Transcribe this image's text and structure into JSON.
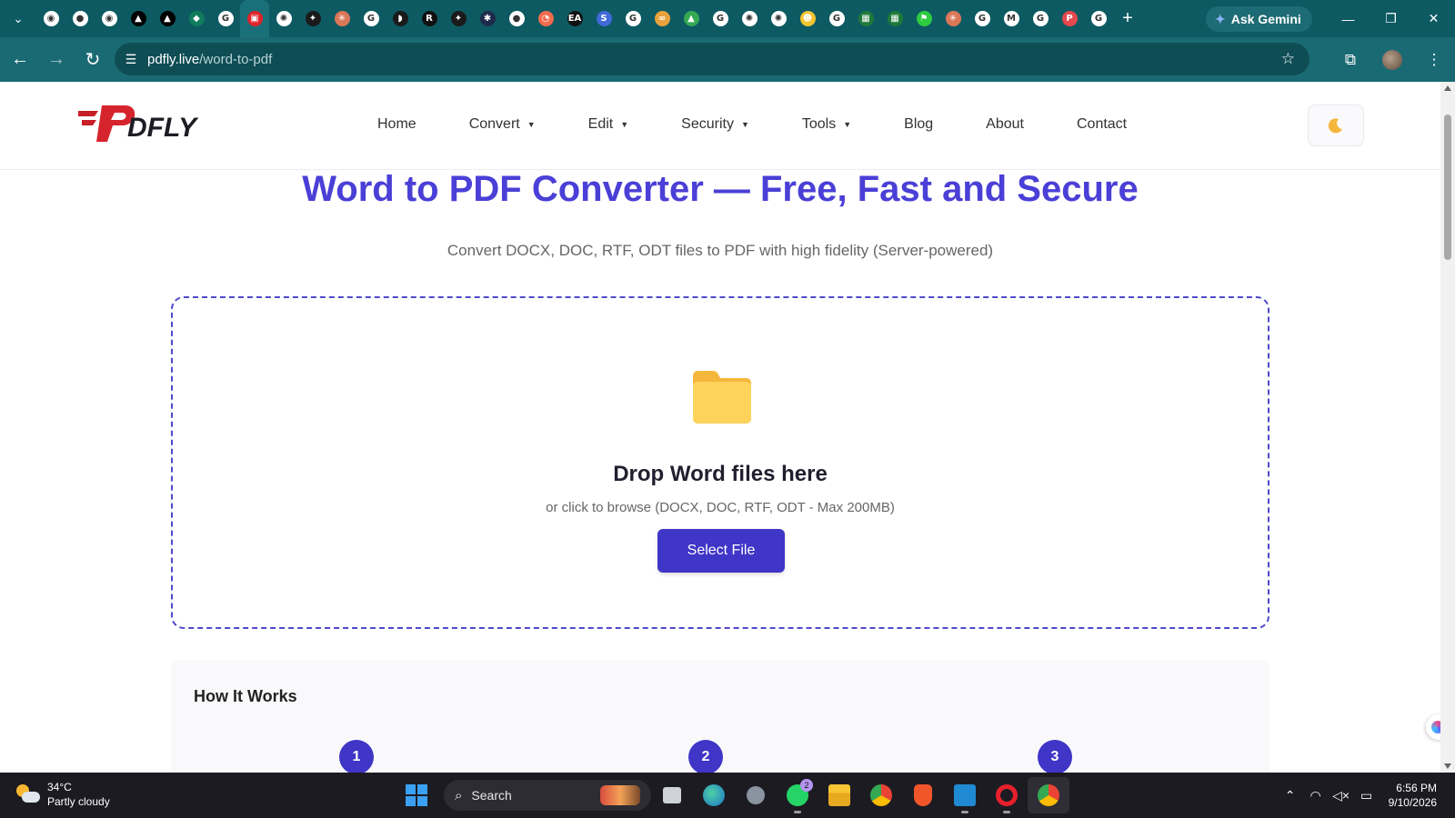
{
  "browser": {
    "tab_icons": [
      {
        "icon": "chrome-icon",
        "color": "#ffffff",
        "glyph": "◉"
      },
      {
        "icon": "github-icon",
        "color": "#ffffff",
        "glyph": "●"
      },
      {
        "icon": "chrome-icon",
        "color": "#ffffff",
        "glyph": "◉"
      },
      {
        "icon": "vercel-icon",
        "color": "#000000",
        "glyph": "▲"
      },
      {
        "icon": "vercel-icon",
        "color": "#000000",
        "glyph": "▲"
      },
      {
        "icon": "shield-icon",
        "color": "#0f7c5c",
        "glyph": "◆"
      },
      {
        "icon": "google-icon",
        "color": "#ffffff",
        "glyph": "G"
      },
      {
        "icon": "pdfly-icon",
        "color": "#e0242b",
        "glyph": "▣"
      },
      {
        "icon": "openai-icon",
        "color": "#ffffff",
        "glyph": "✺"
      },
      {
        "icon": "gemini-icon",
        "color": "#1a1a1a",
        "glyph": "✦"
      },
      {
        "icon": "claude-icon",
        "color": "#d97757",
        "glyph": "✳"
      },
      {
        "icon": "google-icon",
        "color": "#ffffff",
        "glyph": "G"
      },
      {
        "icon": "deepseek-icon",
        "color": "#1a1a1a",
        "glyph": "◗"
      },
      {
        "icon": "r-icon",
        "color": "#111111",
        "glyph": "R"
      },
      {
        "icon": "gemini-icon",
        "color": "#1a1a1a",
        "glyph": "✦"
      },
      {
        "icon": "perplexity-icon",
        "color": "#1e2a4a",
        "glyph": "✱"
      },
      {
        "icon": "github-icon",
        "color": "#ffffff",
        "glyph": "●"
      },
      {
        "icon": "clock-icon",
        "color": "#f26b4e",
        "glyph": "◔"
      },
      {
        "icon": "ea-icon",
        "color": "#111111",
        "glyph": "EA"
      },
      {
        "icon": "stripe-icon",
        "color": "#3f6ad8",
        "glyph": "S"
      },
      {
        "icon": "google-icon",
        "color": "#ffffff",
        "glyph": "G"
      },
      {
        "icon": "infinity-icon",
        "color": "#e9a23b",
        "glyph": "∞"
      },
      {
        "icon": "drive-icon",
        "color": "#34a853",
        "glyph": "▲"
      },
      {
        "icon": "google-icon",
        "color": "#ffffff",
        "glyph": "G"
      },
      {
        "icon": "openai-icon",
        "color": "#ffffff",
        "glyph": "✺"
      },
      {
        "icon": "openai-icon",
        "color": "#ffffff",
        "glyph": "✺"
      },
      {
        "icon": "ghost-icon",
        "color": "#f4c430",
        "glyph": "☻"
      },
      {
        "icon": "google-icon",
        "color": "#ffffff",
        "glyph": "G"
      },
      {
        "icon": "app-icon",
        "color": "#1f7a3a",
        "glyph": "▦"
      },
      {
        "icon": "app-icon",
        "color": "#1f7a3a",
        "glyph": "▦"
      },
      {
        "icon": "flag-icon",
        "color": "#2ecc40",
        "glyph": "⚑"
      },
      {
        "icon": "claude-icon",
        "color": "#d97757",
        "glyph": "✳"
      },
      {
        "icon": "google-icon",
        "color": "#ffffff",
        "glyph": "G"
      },
      {
        "icon": "gmail-icon",
        "color": "#ffffff",
        "glyph": "M"
      },
      {
        "icon": "google-icon",
        "color": "#ffffff",
        "glyph": "G"
      },
      {
        "icon": "p-icon",
        "color": "#e5484d",
        "glyph": "P"
      },
      {
        "icon": "google-icon",
        "color": "#ffffff",
        "glyph": "G"
      }
    ],
    "ask_gemini": "Ask Gemini",
    "url_host": "pdfly.live",
    "url_path": "/word-to-pdf"
  },
  "site": {
    "nav": [
      {
        "label": "Home",
        "dropdown": false
      },
      {
        "label": "Convert",
        "dropdown": true
      },
      {
        "label": "Edit",
        "dropdown": true
      },
      {
        "label": "Security",
        "dropdown": true
      },
      {
        "label": "Tools",
        "dropdown": true
      },
      {
        "label": "Blog",
        "dropdown": false
      },
      {
        "label": "About",
        "dropdown": false
      },
      {
        "label": "Contact",
        "dropdown": false
      }
    ],
    "theme_toggle_icon": "moon-icon"
  },
  "hero": {
    "title": "Word to PDF Converter — Free, Fast and Secure",
    "subtitle": "Convert DOCX, DOC, RTF, ODT files to PDF with high fidelity (Server-powered)"
  },
  "dropzone": {
    "icon": "folder-icon",
    "title": "Drop Word files here",
    "hint": "or click to browse (DOCX, DOC, RTF, ODT - Max 200MB)",
    "button": "Select File"
  },
  "how_it_works": {
    "title": "How It Works",
    "steps": [
      "1",
      "2",
      "3"
    ]
  },
  "taskbar": {
    "weather_temp": "34°C",
    "weather_desc": "Partly cloudy",
    "search_placeholder": "Search",
    "whatsapp_badge": "2",
    "time": "6:56 PM",
    "date": "9/10/2026"
  },
  "colors": {
    "accent": "#4a3fd6",
    "button": "#3f35c7",
    "chrome_bg": "#0d5a63"
  }
}
